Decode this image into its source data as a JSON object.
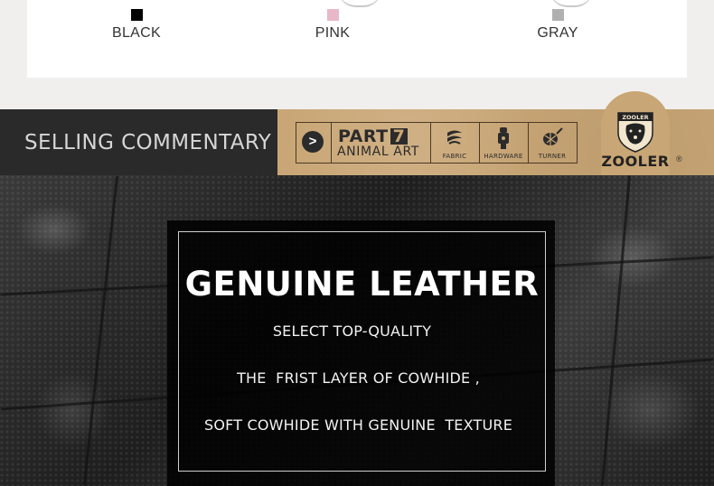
{
  "colors": [
    {
      "label": "BLACK",
      "hex": "#000000"
    },
    {
      "label": "PINK",
      "hex": "#e8b8c8"
    },
    {
      "label": "GRAY",
      "hex": "#b0b0b0"
    }
  ],
  "banner": {
    "title": "SELLING COMMENTARY",
    "part_label": "PART",
    "part_number": "7",
    "part_subtitle": "ANIMAL ART",
    "features": [
      {
        "label": "FABRIC",
        "icon": "fabric-icon"
      },
      {
        "label": "HARDWARE",
        "icon": "hardware-icon"
      },
      {
        "label": "TURNER",
        "icon": "turner-icon"
      }
    ],
    "logo_top": "ZOOLER",
    "logo_text": "ZOOLER",
    "logo_reg": "®",
    "accent_color": "#c9a675"
  },
  "leather": {
    "title": "GENUINE LEATHER",
    "lines": [
      "SELECT TOP-QUALITY",
      "THE  FRIST LAYER OF COWHIDE ,",
      "SOFT COWHIDE WITH GENUINE  TEXTURE"
    ]
  }
}
